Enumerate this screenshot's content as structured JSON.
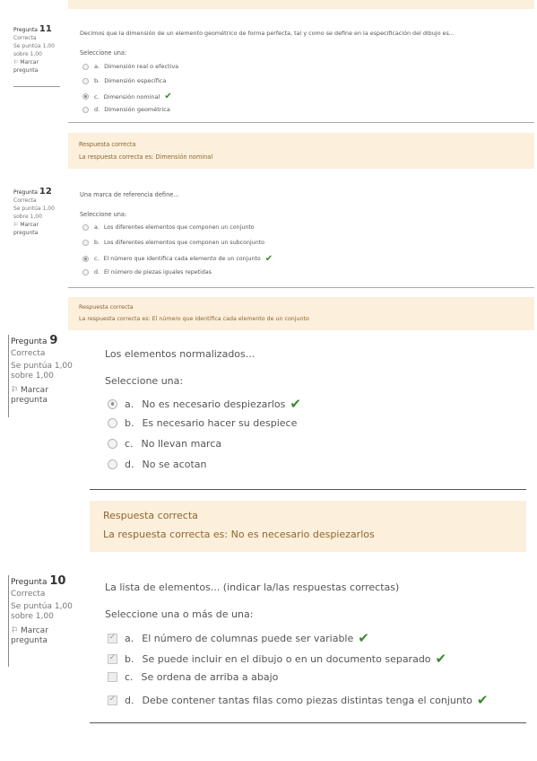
{
  "top_bar": {},
  "q11": {
    "label": "Pregunta",
    "number": "11",
    "status": "Correcta",
    "score": "Se puntúa 1,00 sobre 1,00",
    "flag": "Marcar pregunta",
    "text": "Decimos que la dimensión de un elemento geométrico de forma perfecta, tal y como se define en la especificación del dibujo es...",
    "prompt": "Seleccione una:",
    "options": [
      {
        "letter": "a.",
        "text": "Dimensión real o efectiva"
      },
      {
        "letter": "b.",
        "text": "Dimensión específica"
      },
      {
        "letter": "c.",
        "text": "Dimensión nominal"
      },
      {
        "letter": "d.",
        "text": "Dimensión geométrica"
      }
    ],
    "feedback_title": "Respuesta correcta",
    "feedback_answer": "La respuesta correcta es: Dimensión nominal"
  },
  "q12": {
    "label": "Pregunta",
    "number": "12",
    "status": "Correcta",
    "score": "Se puntúa 1,00 sobre 1,00",
    "flag": "Marcar pregunta",
    "text": "Una marca de referencia define...",
    "prompt": "Seleccione una:",
    "options": [
      {
        "letter": "a.",
        "text": "Los diferentes elementos que componen un conjunto"
      },
      {
        "letter": "b.",
        "text": "Los diferentes elementos que componen un subconjunto"
      },
      {
        "letter": "c.",
        "text": "El número que identifica cada elemento de un conjunto"
      },
      {
        "letter": "d.",
        "text": "El número de piezas iguales repetidas"
      }
    ],
    "feedback_title": "Respuesta correcta",
    "feedback_answer": "La respuesta correcta es: El número que identifica cada elemento de un conjunto"
  },
  "q9": {
    "label": "Pregunta",
    "number": "9",
    "status": "Correcta",
    "score": "Se puntúa 1,00 sobre 1,00",
    "flag": "Marcar pregunta",
    "text": "Los elementos normalizados...",
    "prompt": "Seleccione una:",
    "options": [
      {
        "letter": "a.",
        "text": "No es necesario despiezarlos"
      },
      {
        "letter": "b.",
        "text": "Es necesario hacer su despiece"
      },
      {
        "letter": "c.",
        "text": "No llevan marca"
      },
      {
        "letter": "d.",
        "text": "No se acotan"
      }
    ],
    "feedback_title": "Respuesta correcta",
    "feedback_answer": "La respuesta correcta es: No es necesario despiezarlos"
  },
  "q10": {
    "label": "Pregunta",
    "number": "10",
    "status": "Correcta",
    "score": "Se puntúa 1,00 sobre 1,00",
    "flag": "Marcar pregunta",
    "text": "La lista de elementos... (indicar la/las respuestas correctas)",
    "prompt": "Seleccione una o más de una:",
    "options": [
      {
        "letter": "a.",
        "text": "El número de columnas puede ser variable"
      },
      {
        "letter": "b.",
        "text": "Se puede incluir en el dibujo o en un documento separado"
      },
      {
        "letter": "c.",
        "text": "Se ordena de arriba a abajo"
      },
      {
        "letter": "d.",
        "text": "Debe contener tantas filas como piezas distintas tenga el conjunto"
      }
    ]
  },
  "colors": {
    "feedback_bg": "#fcefdc",
    "feedback_text": "#8e662e",
    "correct_check": "#3a8a2e"
  }
}
